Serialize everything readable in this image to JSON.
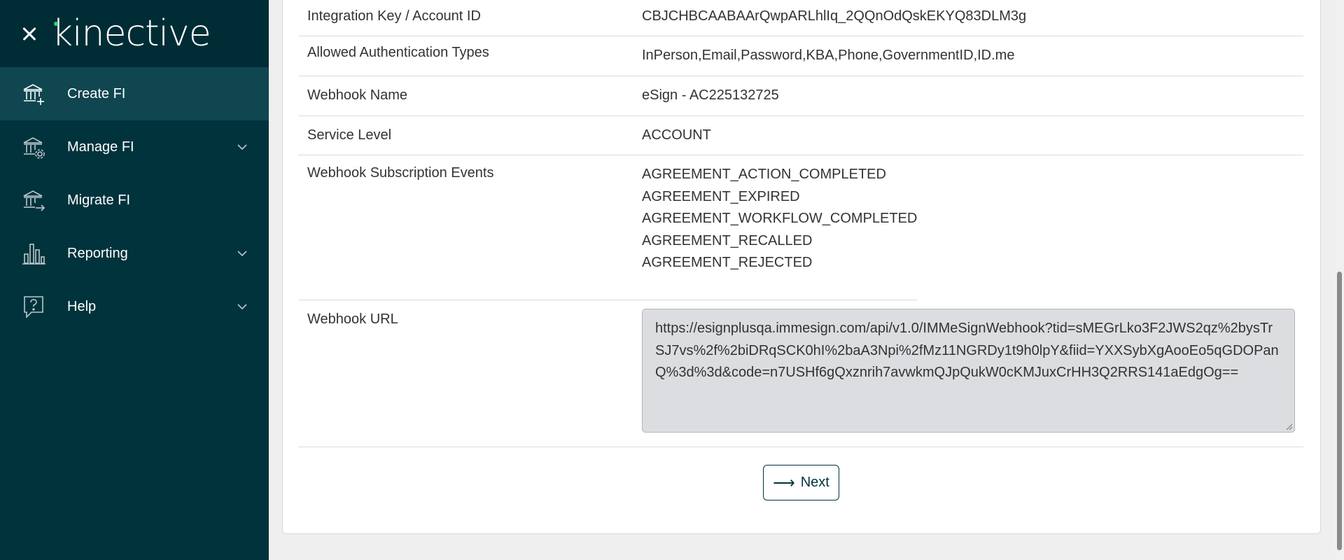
{
  "sidebar": {
    "logo": "kinective",
    "items": [
      {
        "label": "Create FI",
        "icon": "bank-add-icon",
        "active": true
      },
      {
        "label": "Manage FI",
        "icon": "bank-settings-icon",
        "expandable": true
      },
      {
        "label": "Migrate FI",
        "icon": "bank-migrate-icon"
      },
      {
        "label": "Reporting",
        "icon": "bar-chart-icon",
        "expandable": true
      },
      {
        "label": "Help",
        "icon": "help-chat-icon",
        "expandable": true
      }
    ]
  },
  "details": {
    "integration_key": {
      "label": "Integration Key / Account ID",
      "value": "CBJCHBCAABAArQwpARLhlIq_2QQnOdQskEKYQ83DLM3g"
    },
    "auth_types": {
      "label": "Allowed Authentication Types",
      "value": "InPerson,Email,Password,KBA,Phone,GovernmentID,ID.me"
    },
    "webhook_name": {
      "label": "Webhook Name",
      "value": "eSign - AC225132725"
    },
    "service_level": {
      "label": "Service Level",
      "value": "ACCOUNT"
    },
    "subscription_events": {
      "label": "Webhook Subscription Events",
      "values": [
        "AGREEMENT_ACTION_COMPLETED",
        "AGREEMENT_EXPIRED",
        "AGREEMENT_WORKFLOW_COMPLETED",
        "AGREEMENT_RECALLED",
        "AGREEMENT_REJECTED"
      ]
    },
    "webhook_url": {
      "label": "Webhook URL",
      "value": "https://esignplusqa.immesign.com/api/v1.0/IMMeSignWebhook?tid=sMEGrLko3F2JWS2qz%2bysTrSJ7vs%2f%2biDRqSCK0hI%2baA3Npi%2fMz11NGRDy1t9h0lpY&fiid=YXXSybXgAooEo5qGDOPanQ%3d%3d&code=n7USHf6gQxznrih7avwkmQJpQukW0cKMJuxCrHH3Q2RRS141aEdgOg=="
    }
  },
  "actions": {
    "next_label": "Next",
    "next_icon": "arrow-right-icon"
  },
  "colors": {
    "sidebar_bg": "#01333c",
    "sidebar_active": "#0f4650",
    "logo_dot": "#35d07f",
    "textarea_bg": "#dcdde0"
  }
}
